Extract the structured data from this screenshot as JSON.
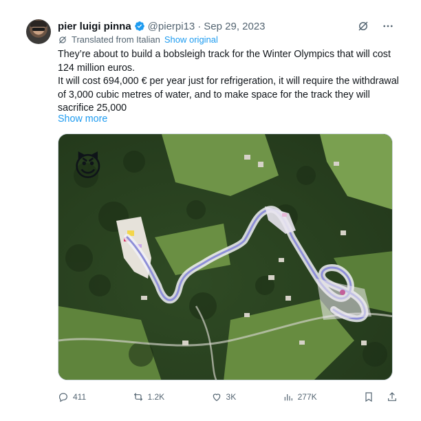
{
  "author": {
    "name": "pier luigi pinna",
    "handle": "@pierpi13",
    "separator": "·",
    "date": "Sep 29, 2023"
  },
  "translation": {
    "text": "Translated from Italian",
    "link": "Show original"
  },
  "post": {
    "line1": "They’re about to build a bobsleigh track for the Winter Olympics that will cost 124 million euros.",
    "line2": "It will cost 694,000 € per year just for refrigeration, it will require the withdrawal of 3,000 cubic metres of water, and to make space for the track they will sacrifice 25,000",
    "show_more": "Show more"
  },
  "media": {
    "emoji": "😈"
  },
  "actions": {
    "replies": "411",
    "reposts": "1.2K",
    "likes": "3K",
    "views": "277K"
  },
  "icons": [
    "verified-badge-icon",
    "grok-icon",
    "more-icon",
    "translate-icon",
    "reply-icon",
    "repost-icon",
    "like-icon",
    "views-icon",
    "bookmark-icon",
    "share-icon"
  ],
  "colors": {
    "accent": "#1d9bf0",
    "muted": "#536471",
    "text": "#0f1419"
  }
}
